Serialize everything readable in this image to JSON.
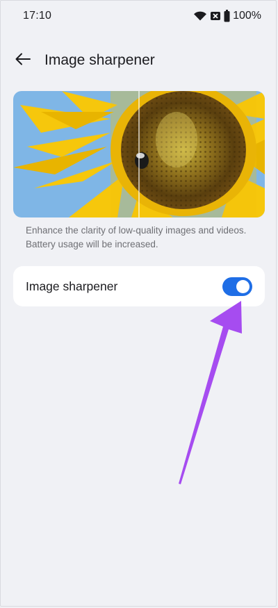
{
  "status_bar": {
    "time": "17:10",
    "battery": "100%",
    "icons": [
      "wifi-icon",
      "sim-blocked-icon",
      "battery-icon"
    ]
  },
  "header": {
    "back_icon": "arrow-left-icon",
    "title": "Image sharpener"
  },
  "preview": {
    "description_line1": "Enhance the clarity of low-quality images and videos.",
    "description_line2": "Battery usage will be increased."
  },
  "setting": {
    "label": "Image sharpener",
    "enabled": true,
    "toggle_color": "#1f6ee6"
  },
  "colors": {
    "background": "#f0f1f5",
    "card": "#ffffff",
    "accent": "#1f6ee6",
    "annotation_arrow": "#a64cf0"
  }
}
